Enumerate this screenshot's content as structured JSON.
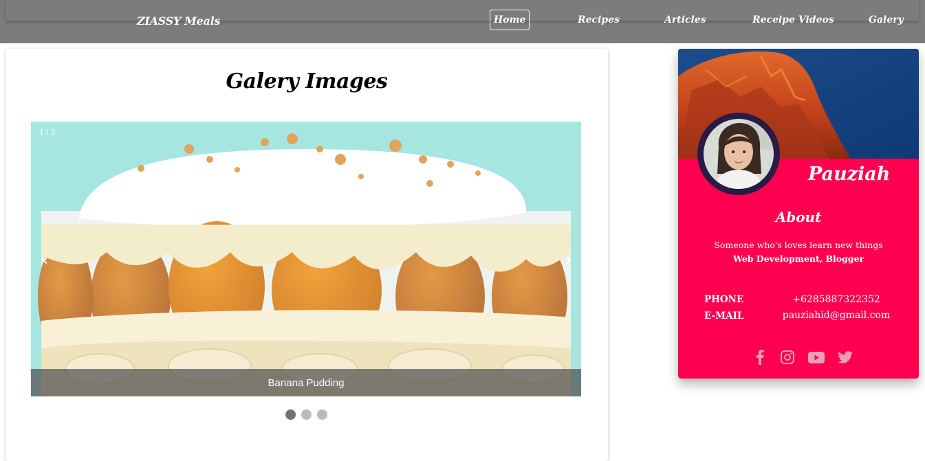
{
  "navbar": {
    "brand": "ZIASSY Meals",
    "items": [
      {
        "label": "Home",
        "active": true
      },
      {
        "label": "Recipes"
      },
      {
        "label": "Articles"
      },
      {
        "label": "Receipe Videos"
      },
      {
        "label": "Galery"
      }
    ]
  },
  "gallery": {
    "title": "Galery Images",
    "counter": "1 / 3",
    "caption": "Banana Pudding",
    "prev_icon": "‹",
    "next_icon": "›",
    "dots": 3,
    "active_dot": 0
  },
  "profile": {
    "name": "Pauziah",
    "about_title": "About",
    "about_line1": "Someone who's loves learn new things",
    "about_line2": "Web Development, Blogger",
    "phone_label": "PHONE",
    "phone_value": "+6285887322352",
    "email_label": "E-MAIL",
    "email_value": "pauziahid@gmail.com",
    "socials": [
      "facebook-icon",
      "instagram-icon",
      "youtube-icon",
      "twitter-icon"
    ]
  },
  "colors": {
    "navbar": "#7c7c7c",
    "profile_bg": "#ff0050",
    "avatar_ring": "#2b1a45",
    "social_icon": "#e9a0b8"
  }
}
